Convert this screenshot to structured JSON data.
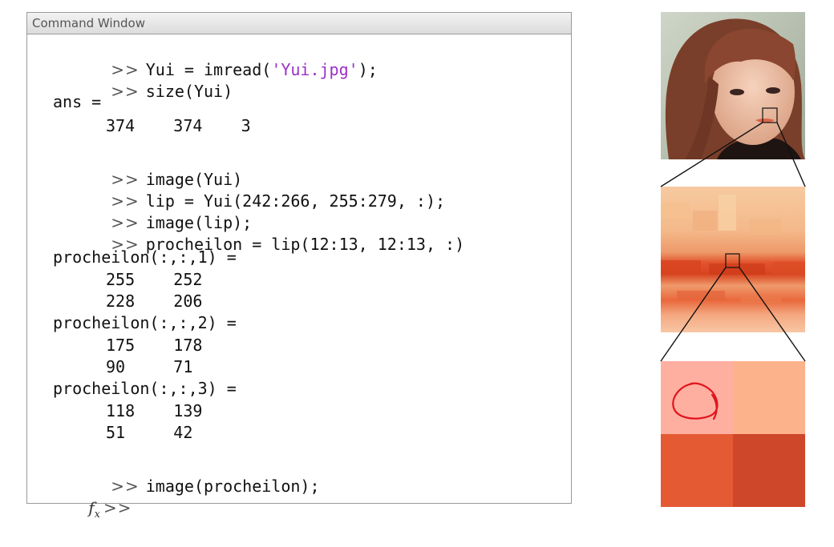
{
  "window": {
    "title": "Command Window",
    "prompt": ">>",
    "fx_label": "f",
    "fx_sub": "x"
  },
  "lines": {
    "l1": {
      "pre": "Yui = imread(",
      "str": "'Yui.jpg'",
      "post": ");"
    },
    "l2": "size(Yui)",
    "l3": "ans =",
    "l4": "374    374    3",
    "l5": "image(Yui)",
    "l6": "lip = Yui(242:266, 255:279, :);",
    "l7": "image(lip);",
    "l8": "procheilon = lip(12:13, 12:13, :)",
    "l9": "procheilon(:,:,1) =",
    "l10": "255    252",
    "l11": "228    206",
    "l12": "procheilon(:,:,2) =",
    "l13": "175    178",
    "l14": "90     71",
    "l15": "procheilon(:,:,3) =",
    "l16": "118    139",
    "l17": "51     42",
    "l18": "image(procheilon);"
  },
  "pixels": {
    "top_left": "#ffafa0",
    "top_right": "#fcb28b",
    "bottom_left": "#e45a33",
    "bottom_right": "#ce472a",
    "annotation_color": "#e0141e"
  }
}
